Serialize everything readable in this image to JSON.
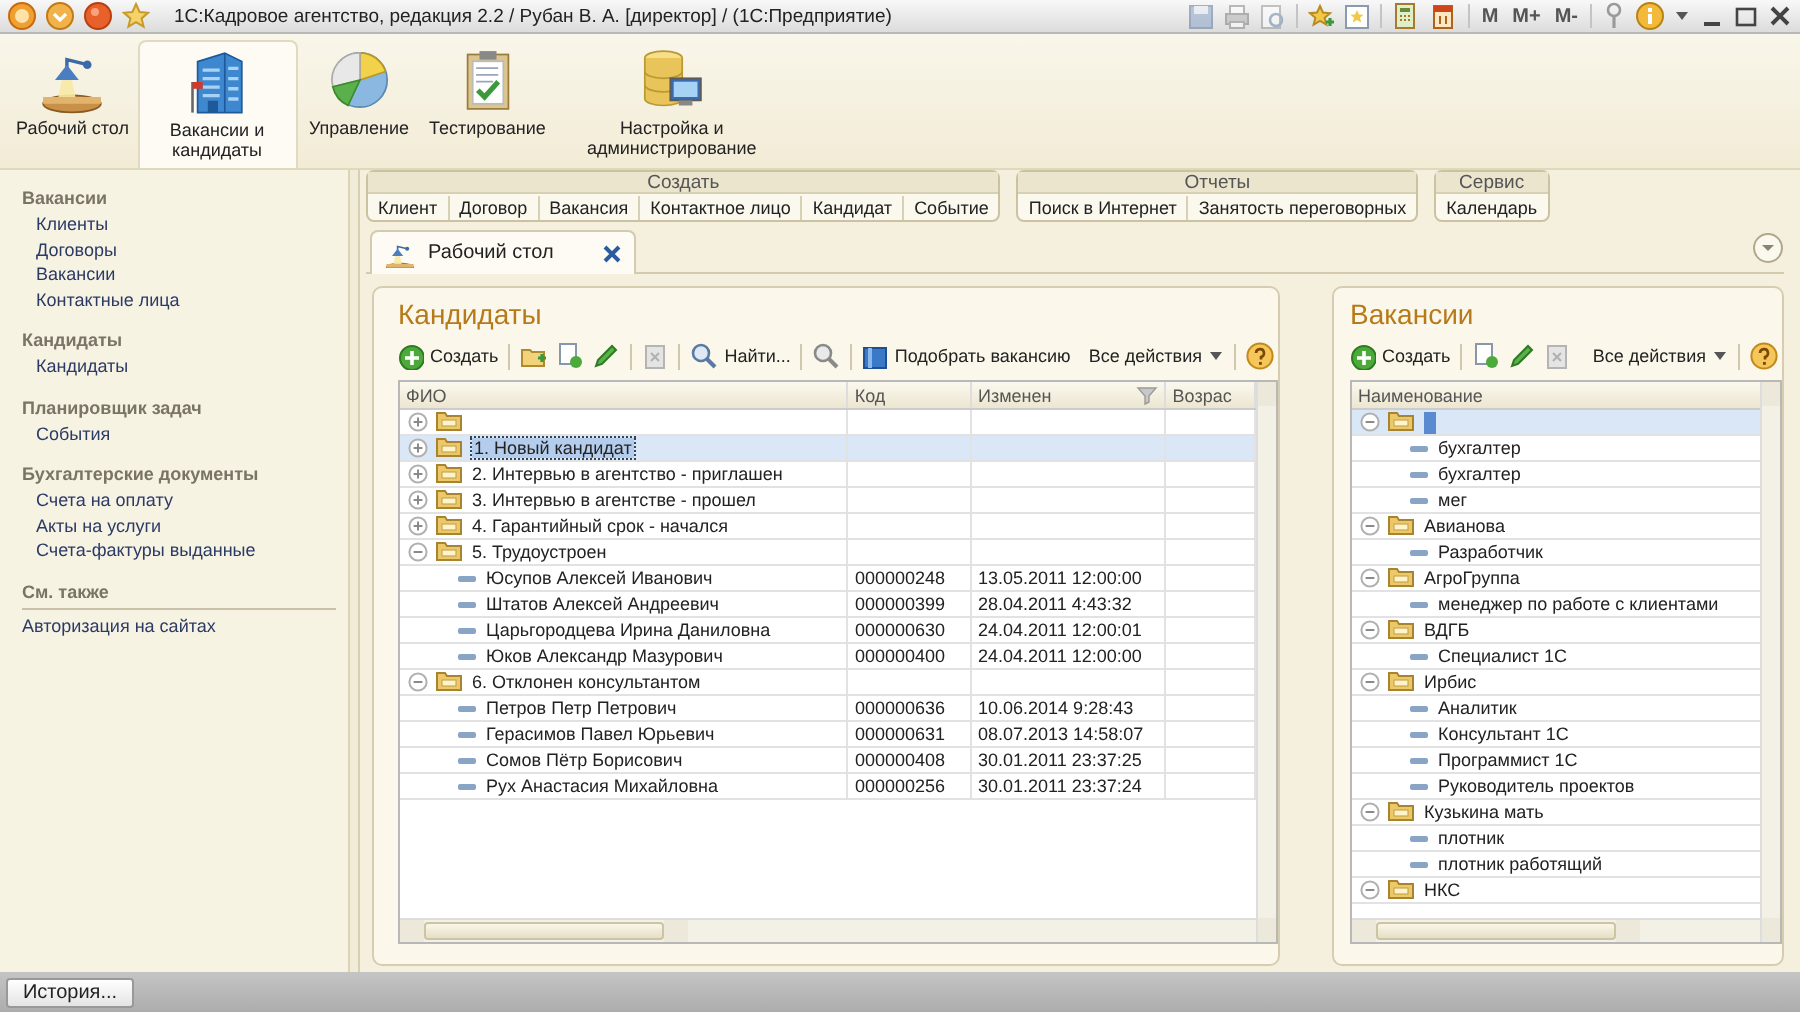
{
  "window": {
    "title": "1С:Кадровое агентство, редакция 2.2 / Рубан В. А. [директор] /  (1С:Предприятие)",
    "memory_buttons": [
      "M",
      "M+",
      "M-"
    ]
  },
  "sections": [
    {
      "label": "Рабочий стол",
      "selected": false
    },
    {
      "label": "Вакансии и кандидаты",
      "selected": true
    },
    {
      "label": "Управление",
      "selected": false
    },
    {
      "label": "Тестирование",
      "selected": false
    },
    {
      "label": "Настройка и администрирование",
      "selected": false
    }
  ],
  "sidebar": {
    "groups": [
      {
        "heading": "Вакансии",
        "items": [
          "Клиенты",
          "Договоры",
          "Вакансии",
          "Контактные лица"
        ]
      },
      {
        "heading": "Кандидаты",
        "items": [
          "Кандидаты"
        ]
      },
      {
        "heading": "Планировщик задач",
        "items": [
          "События"
        ]
      },
      {
        "heading": "Бухгалтерские документы",
        "items": [
          "Счета на оплату",
          "Акты на услуги",
          "Счета-фактуры выданные"
        ]
      }
    ],
    "see_also": {
      "heading": "См. также",
      "items": [
        "Авторизация на сайтах"
      ]
    }
  },
  "command_bar": [
    {
      "title": "Создать",
      "buttons": [
        "Клиент",
        "Договор",
        "Вакансия",
        "Контактное лицо",
        "Кандидат",
        "Событие"
      ]
    },
    {
      "title": "Отчеты",
      "buttons": [
        "Поиск в Интернет",
        "Занятость переговорных"
      ]
    },
    {
      "title": "Сервис",
      "buttons": [
        "Календарь"
      ]
    }
  ],
  "tabs": [
    {
      "label": "Рабочий стол",
      "selected": true
    }
  ],
  "candidates": {
    "title": "Кандидаты",
    "create": "Создать",
    "find": "Найти...",
    "pick": "Подобрать вакансию",
    "all_actions": "Все действия",
    "columns": [
      "ФИО",
      "Код",
      "Изменен",
      "Возрас"
    ],
    "rows": [
      {
        "kind": "group",
        "expanded": false,
        "selected": false
      },
      {
        "kind": "group",
        "name": "1. Новый кандидат",
        "expanded": false,
        "selected": true
      },
      {
        "kind": "group",
        "name": "2. Интервью в агентство - приглашен",
        "expanded": false,
        "selected": false
      },
      {
        "kind": "group",
        "name": "3. Интервью в агентстве - прошел",
        "expanded": false,
        "selected": false
      },
      {
        "kind": "group",
        "name": "4. Гарантийный срок - начался",
        "expanded": false,
        "selected": false
      },
      {
        "kind": "group",
        "name": "5. Трудоустроен",
        "expanded": true,
        "selected": false,
        "children": [
          {
            "kind": "item",
            "name": "Юсупов Алексей Иванович",
            "code": "000000248",
            "changed": "13.05.2011 12:00:00",
            "selected": false
          },
          {
            "kind": "item",
            "name": "Штатов Алексей Андреевич",
            "code": "000000399",
            "changed": "28.04.2011 4:43:32",
            "selected": false
          },
          {
            "kind": "item",
            "name": "Царьгородцева Ирина Даниловна",
            "code": "000000630",
            "changed": "24.04.2011 12:00:01",
            "selected": false
          },
          {
            "kind": "item",
            "name": "Юков Александр Мазурович",
            "code": "000000400",
            "changed": "24.04.2011 12:00:00",
            "selected": false
          }
        ]
      },
      {
        "kind": "group",
        "name": "6. Отклонен консультантом",
        "expanded": true,
        "selected": false,
        "children": [
          {
            "kind": "item",
            "name": "Петров Петр Петрович",
            "code": "000000636",
            "changed": "10.06.2014 9:28:43",
            "selected": false
          },
          {
            "kind": "item",
            "name": "Герасимов Павел Юрьевич",
            "code": "000000631",
            "changed": "08.07.2013 14:58:07",
            "selected": false
          },
          {
            "kind": "item",
            "name": "Сомов Пётр Борисович",
            "code": "000000408",
            "changed": "30.01.2011 23:37:25",
            "selected": false
          },
          {
            "kind": "item",
            "name": "Рух Анастасия Михайловна",
            "code": "000000256",
            "changed": "30.01.2011 23:37:24",
            "selected": false
          }
        ]
      }
    ]
  },
  "vacancies": {
    "title": "Вакансии",
    "create": "Создать",
    "all_actions": "Все действия",
    "columns": [
      "Наименование"
    ],
    "rows": [
      {
        "kind": "group",
        "expanded": true,
        "selected": true,
        "children": [
          {
            "kind": "item",
            "name": "бухгалтер",
            "selected": false
          },
          {
            "kind": "item",
            "name": "бухгалтер",
            "selected": false
          },
          {
            "kind": "item",
            "name": "мег",
            "selected": false
          }
        ]
      },
      {
        "kind": "group",
        "name": "Авианова",
        "expanded": true,
        "selected": false,
        "children": [
          {
            "kind": "item",
            "name": "Разработчик",
            "selected": false
          }
        ]
      },
      {
        "kind": "group",
        "name": "АгроГруппа",
        "expanded": true,
        "selected": false,
        "children": [
          {
            "kind": "item",
            "name": "менеджер по работе с клиентами",
            "selected": false
          }
        ]
      },
      {
        "kind": "group",
        "name": "ВДГБ",
        "expanded": true,
        "selected": false,
        "children": [
          {
            "kind": "item",
            "name": "Специалист 1С",
            "selected": false
          }
        ]
      },
      {
        "kind": "group",
        "name": "Ирбис",
        "expanded": true,
        "selected": false,
        "children": [
          {
            "kind": "item",
            "name": "Аналитик",
            "selected": false
          },
          {
            "kind": "item",
            "name": "Консультант 1С",
            "selected": false
          },
          {
            "kind": "item",
            "name": "Программист 1С",
            "selected": false
          },
          {
            "kind": "item",
            "name": "Руководитель проектов",
            "selected": false
          }
        ]
      },
      {
        "kind": "group",
        "name": "Кузькина мать",
        "expanded": true,
        "selected": false,
        "children": [
          {
            "kind": "item",
            "name": "плотник",
            "selected": false
          },
          {
            "kind": "item",
            "name": "плотник работящий",
            "selected": false
          }
        ]
      },
      {
        "kind": "group",
        "name": "НКС",
        "expanded": true,
        "selected": false
      }
    ]
  },
  "status_bar": {
    "history_button": "История..."
  }
}
